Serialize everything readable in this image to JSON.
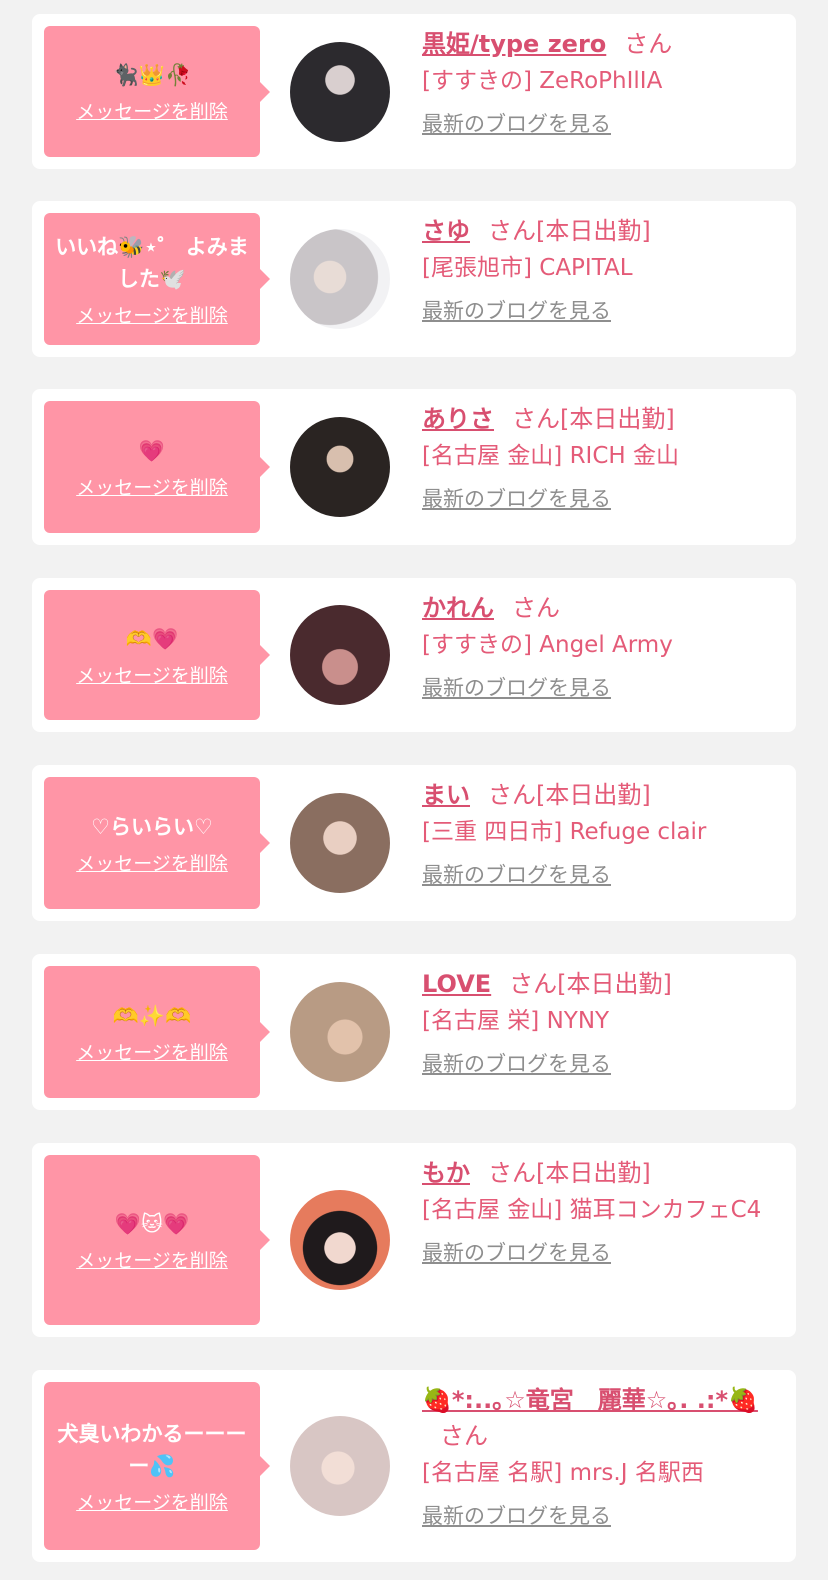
{
  "delete_label": "メッセージを削除",
  "blog_label": "最新のブログを見る",
  "colors": {
    "bubble": "#ff95a6",
    "accent": "#d84f70",
    "text": "#e45b78",
    "muted": "#8e8e8e",
    "background": "#f2f2f2"
  },
  "items": [
    {
      "message": "🐈‍⬛👑🥀",
      "name": "黒姫/type zero",
      "san": "さん",
      "status": "",
      "shop": "[すすきの] ZeRoPhIlIA"
    },
    {
      "message": "いいね🐝⋆゜ よみました🕊️",
      "name": "さゆ",
      "san": "さん",
      "status": "[本日出勤]",
      "shop": "[尾張旭市] CAPITAL"
    },
    {
      "message": "💗",
      "name": "ありさ",
      "san": "さん",
      "status": "[本日出勤]",
      "shop": "[名古屋 金山] RICH 金山"
    },
    {
      "message": "🫶💗",
      "name": "かれん",
      "san": "さん",
      "status": "",
      "shop": "[すすきの] Angel Army"
    },
    {
      "message": "♡らいらい♡",
      "name": "まい",
      "san": "さん",
      "status": "[本日出勤]",
      "shop": "[三重 四日市] Refuge clair"
    },
    {
      "message": "🫶✨🫶",
      "name": "LOVE",
      "san": "さん",
      "status": "[本日出勤]",
      "shop": "[名古屋 栄] NYNY"
    },
    {
      "message": "💗🐱💗",
      "name": "もか",
      "san": "さん",
      "status": "[本日出勤]",
      "shop": "[名古屋 金山] 猫耳コンカフェC4"
    },
    {
      "message": "犬臭いわかるーーーー💦",
      "name": "🍓*:..｡☆竜宮　麗華☆｡. .:*🍓",
      "san": "さん",
      "status": "",
      "shop": "[名古屋 名駅] mrs.J 名駅西"
    }
  ]
}
